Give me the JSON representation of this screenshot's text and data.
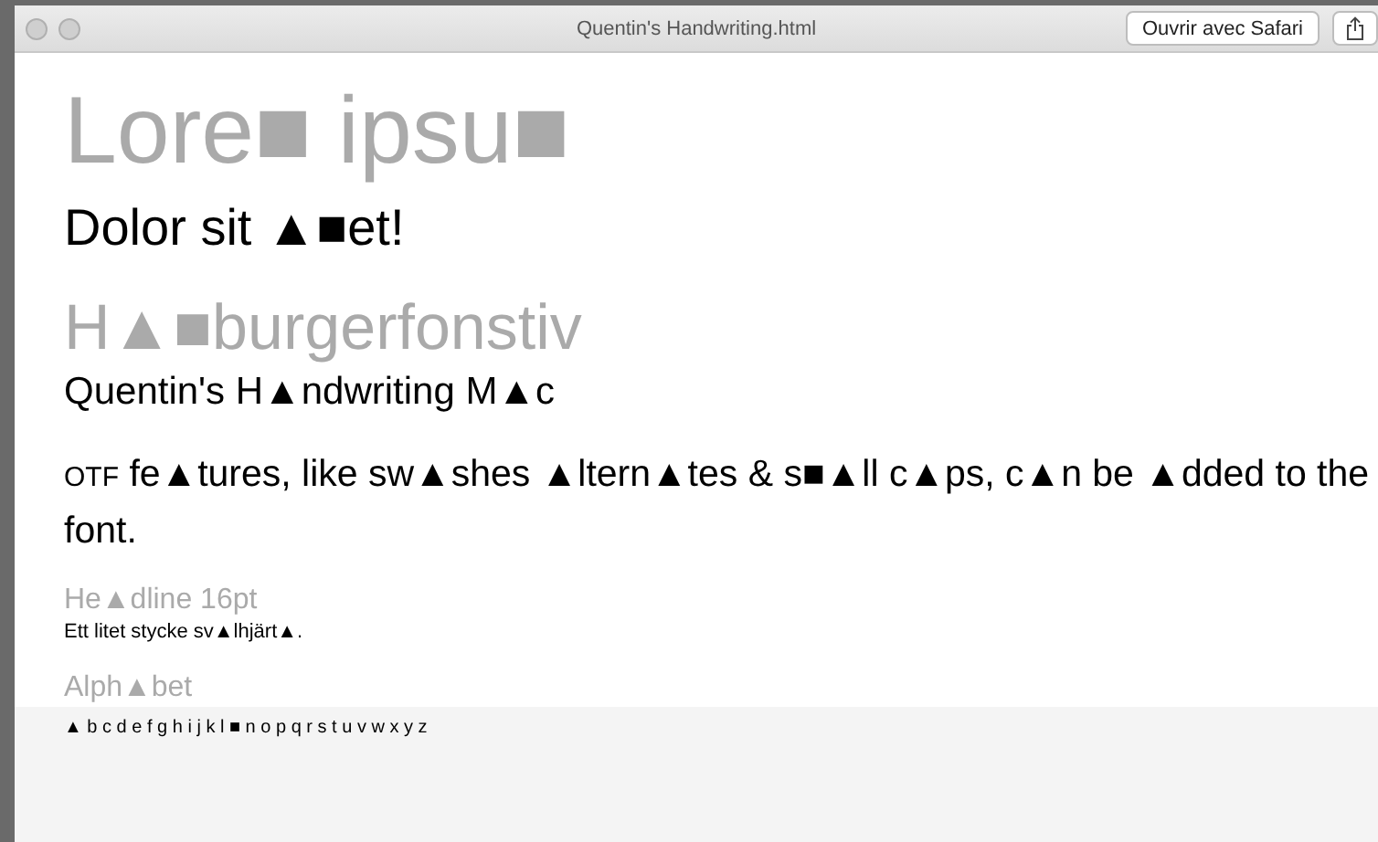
{
  "window": {
    "title": "Quentin's Handwriting.html",
    "open_button": "Ouvrir avec Safari"
  },
  "content": [
    {
      "kind": "display",
      "text": "Lore■ ipsu■"
    },
    {
      "kind": "lead",
      "text": "Dolor sit ▲■et!"
    },
    {
      "kind": "heading",
      "text": "H▲■burgerfonstiv"
    },
    {
      "kind": "subtitle",
      "text": "Quentin's H▲ndwriting M▲c"
    },
    {
      "kind": "paragraph",
      "prefix": "OTF",
      "text": "fe▲tures, like sw▲shes ▲ltern▲tes & s■▲ll c▲ps, c▲n be ▲dded to the font."
    },
    {
      "kind": "label",
      "text": "He▲dline 16pt"
    },
    {
      "kind": "small",
      "text": "Ett litet stycke sv▲lhjärt▲."
    },
    {
      "kind": "label",
      "text": "Alph▲bet"
    },
    {
      "kind": "alphabet",
      "text": "▲ b c d e f g h i j k l ■ n o p q r s t u v w x y z"
    }
  ]
}
